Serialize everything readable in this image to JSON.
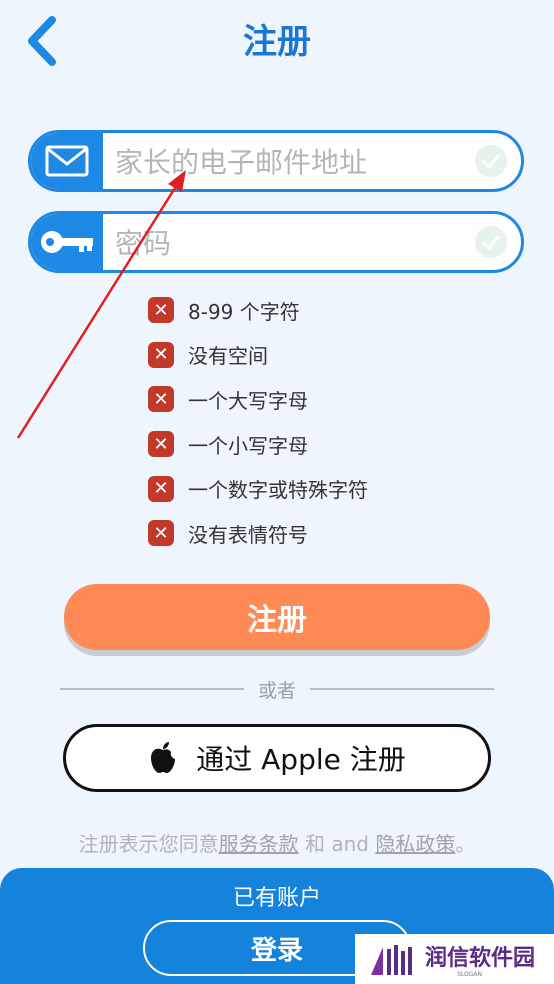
{
  "header": {
    "title": "注册",
    "back_icon": "chevron-left-icon"
  },
  "email_field": {
    "placeholder": "家长的电子邮件地址",
    "value": "",
    "icon": "mail-icon"
  },
  "password_field": {
    "placeholder": "密码",
    "value": "",
    "icon": "key-icon"
  },
  "password_rules": [
    {
      "label": "8-99 个字符",
      "status": "unmet"
    },
    {
      "label": "没有空间",
      "status": "unmet"
    },
    {
      "label": "一个大写字母",
      "status": "unmet"
    },
    {
      "label": "一个小写字母",
      "status": "unmet"
    },
    {
      "label": "一个数字或特殊字符",
      "status": "unmet"
    },
    {
      "label": "没有表情符号",
      "status": "unmet"
    }
  ],
  "register_button": {
    "label": "注册"
  },
  "divider": {
    "label": "或者"
  },
  "apple_button": {
    "label": "通过 Apple 注册",
    "icon": "apple-logo-icon"
  },
  "terms": {
    "prefix": "注册表示您同意",
    "terms_link": "服务条款",
    "middle": " 和 and ",
    "privacy_link": "隐私政策",
    "suffix": "。"
  },
  "footer": {
    "have_account": "已有账户",
    "login_button": "登录"
  },
  "watermark": {
    "text": "润信软件园",
    "slogan": "SLOGAN"
  },
  "colors": {
    "primary": "#1e88e5",
    "title": "#1976d2",
    "register_button": "#ff8a55",
    "error": "#c0392b",
    "footer": "#1583dc",
    "background": "#eef5fc",
    "annotation_arrow": "#e02020"
  }
}
